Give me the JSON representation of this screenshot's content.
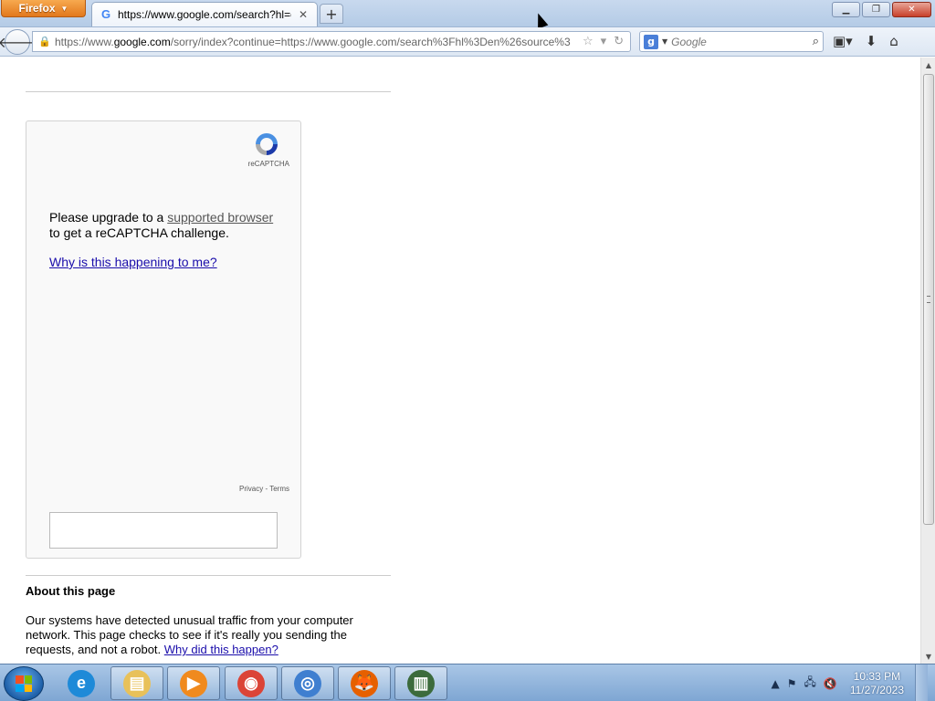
{
  "browser": {
    "menu_button_label": "Firefox",
    "tab_title": "https://www.google.com/search?hl=en...",
    "url_prefix": "https://www.",
    "url_host": "google.com",
    "url_rest": "/sorry/index?continue=https://www.google.com/search%3Fhl%3Den%26source%3",
    "search_placeholder": "Google",
    "search_engine_letter": "g"
  },
  "captcha": {
    "brand_label": "reCAPTCHA",
    "upgrade_prefix": "Please upgrade to a ",
    "upgrade_link": "supported browser",
    "upgrade_suffix": "to get a reCAPTCHA challenge.",
    "why_link": "Why is this happening to me?",
    "privacy_link": "Privacy",
    "separator": " - ",
    "terms_link": "Terms"
  },
  "about": {
    "title": "About this page",
    "text": "Our systems have detected unusual traffic from your computer network. This page checks to see if it's really you sending the requests, and not a robot.",
    "link": "Why did this happen?"
  },
  "taskbar": {
    "apps": [
      {
        "name": "internet-explorer",
        "color": "#1e8ad8"
      },
      {
        "name": "file-explorer",
        "color": "#e8c15a"
      },
      {
        "name": "media-player",
        "color": "#f08a1e"
      },
      {
        "name": "chrome",
        "color": "#db4437"
      },
      {
        "name": "chromium",
        "color": "#3f7fd0"
      },
      {
        "name": "firefox",
        "color": "#e66000"
      },
      {
        "name": "task-manager",
        "color": "#3c6b3c"
      }
    ],
    "time": "10:33 PM",
    "date": "11/27/2023"
  },
  "colors": {
    "link": "#1a0dab",
    "firefox_orange": "#e2781c",
    "taskbar": "#7ea6d3"
  }
}
